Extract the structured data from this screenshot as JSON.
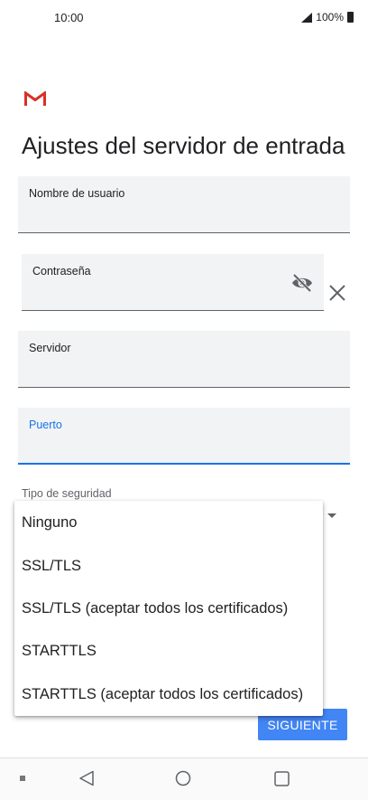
{
  "status_bar": {
    "time": "10:00",
    "battery_text": "100%"
  },
  "app": {
    "logo_icon": "gmail-m-icon",
    "accent_color": "#d93025"
  },
  "page": {
    "title": "Ajustes del servidor de entrada"
  },
  "form": {
    "username_label": "Nombre de usuario",
    "password_label": "Contraseña",
    "server_label": "Servidor",
    "port_label": "Puerto",
    "security_type_label": "Tipo de seguridad",
    "focus_color": "#1a73e8"
  },
  "security_menu": {
    "options": [
      "Ninguno",
      "SSL/TLS",
      "SSL/TLS (aceptar todos los certificados)",
      "STARTTLS",
      "STARTTLS (aceptar todos los certificados)"
    ]
  },
  "actions": {
    "next_label": "SIGUIENTE",
    "next_color": "#4285f4"
  }
}
